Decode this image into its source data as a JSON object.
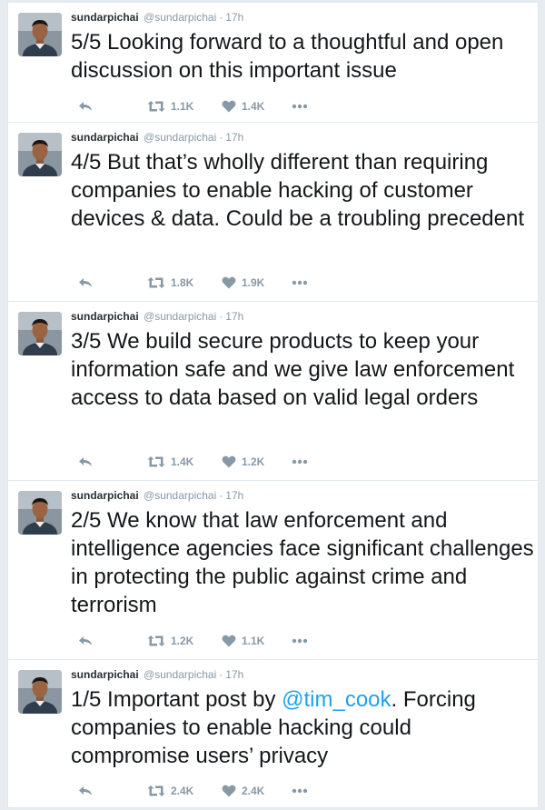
{
  "user": {
    "name": "sundarpichai",
    "handle": "@sundarpichai",
    "separator": "·"
  },
  "tweets": [
    {
      "time": "17h",
      "text_before": "5/5 Looking forward to a thoughtful and open discussion on this important issue",
      "mention": "",
      "text_after": "",
      "retweets": "1.1K",
      "likes": "1.4K"
    },
    {
      "time": "17h",
      "text_before": "4/5 But that’s wholly different than requiring companies to enable hacking of customer devices & data. Could be a troubling precedent",
      "mention": "",
      "text_after": "",
      "retweets": "1.8K",
      "likes": "1.9K"
    },
    {
      "time": "17h",
      "text_before": "3/5 We build secure products to keep your information safe and we give law enforcement access to data based on valid legal orders",
      "mention": "",
      "text_after": "",
      "retweets": "1.4K",
      "likes": "1.2K"
    },
    {
      "time": "17h",
      "text_before": "2/5 We know that law enforcement and intelligence agencies face significant challenges in protecting the public against crime and terrorism",
      "mention": "",
      "text_after": "",
      "retweets": "1.2K",
      "likes": "1.1K"
    },
    {
      "time": "17h",
      "text_before": "1/5 Important post by ",
      "mention": "@tim_cook",
      "text_after": ". Forcing companies to enable hacking could compromise users’ privacy",
      "retweets": "2.4K",
      "likes": "2.4K"
    }
  ],
  "icons": {
    "reply": "reply-icon",
    "retweet": "retweet-icon",
    "like": "heart-icon",
    "more": "more-icon"
  },
  "colors": {
    "mention": "#1da1f2",
    "icon": "#8899a6",
    "text": "#14171a"
  }
}
